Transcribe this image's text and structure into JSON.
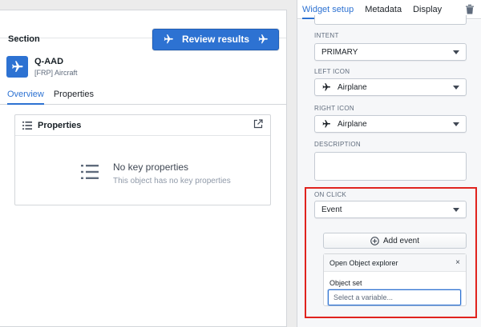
{
  "preview": {
    "section_title": "Section",
    "review_button_label": "Review results",
    "object": {
      "title": "Q-AAD",
      "subtitle": "[FRP] Aircraft"
    },
    "tabs": [
      "Overview",
      "Properties"
    ],
    "properties_card": {
      "title": "Properties",
      "empty_title": "No key properties",
      "empty_subtitle": "This object has no key properties"
    }
  },
  "panel": {
    "tabs": [
      "Widget setup",
      "Metadata",
      "Display"
    ],
    "intent": {
      "label": "INTENT",
      "value": "PRIMARY"
    },
    "left_icon": {
      "label": "LEFT ICON",
      "value": "Airplane",
      "icon": "airplane-icon"
    },
    "right_icon": {
      "label": "RIGHT ICON",
      "value": "Airplane",
      "icon": "airplane-icon"
    },
    "description": {
      "label": "DESCRIPTION",
      "value": ""
    },
    "on_click": {
      "label": "ON CLICK",
      "value": "Event"
    },
    "add_event_label": "Add event",
    "event": {
      "title": "Open Object explorer",
      "close": "×",
      "object_set_label": "Object set",
      "object_set_placeholder": "Select a variable..."
    }
  },
  "colors": {
    "primary": "#2d72d2",
    "highlight": "#e0231e"
  }
}
